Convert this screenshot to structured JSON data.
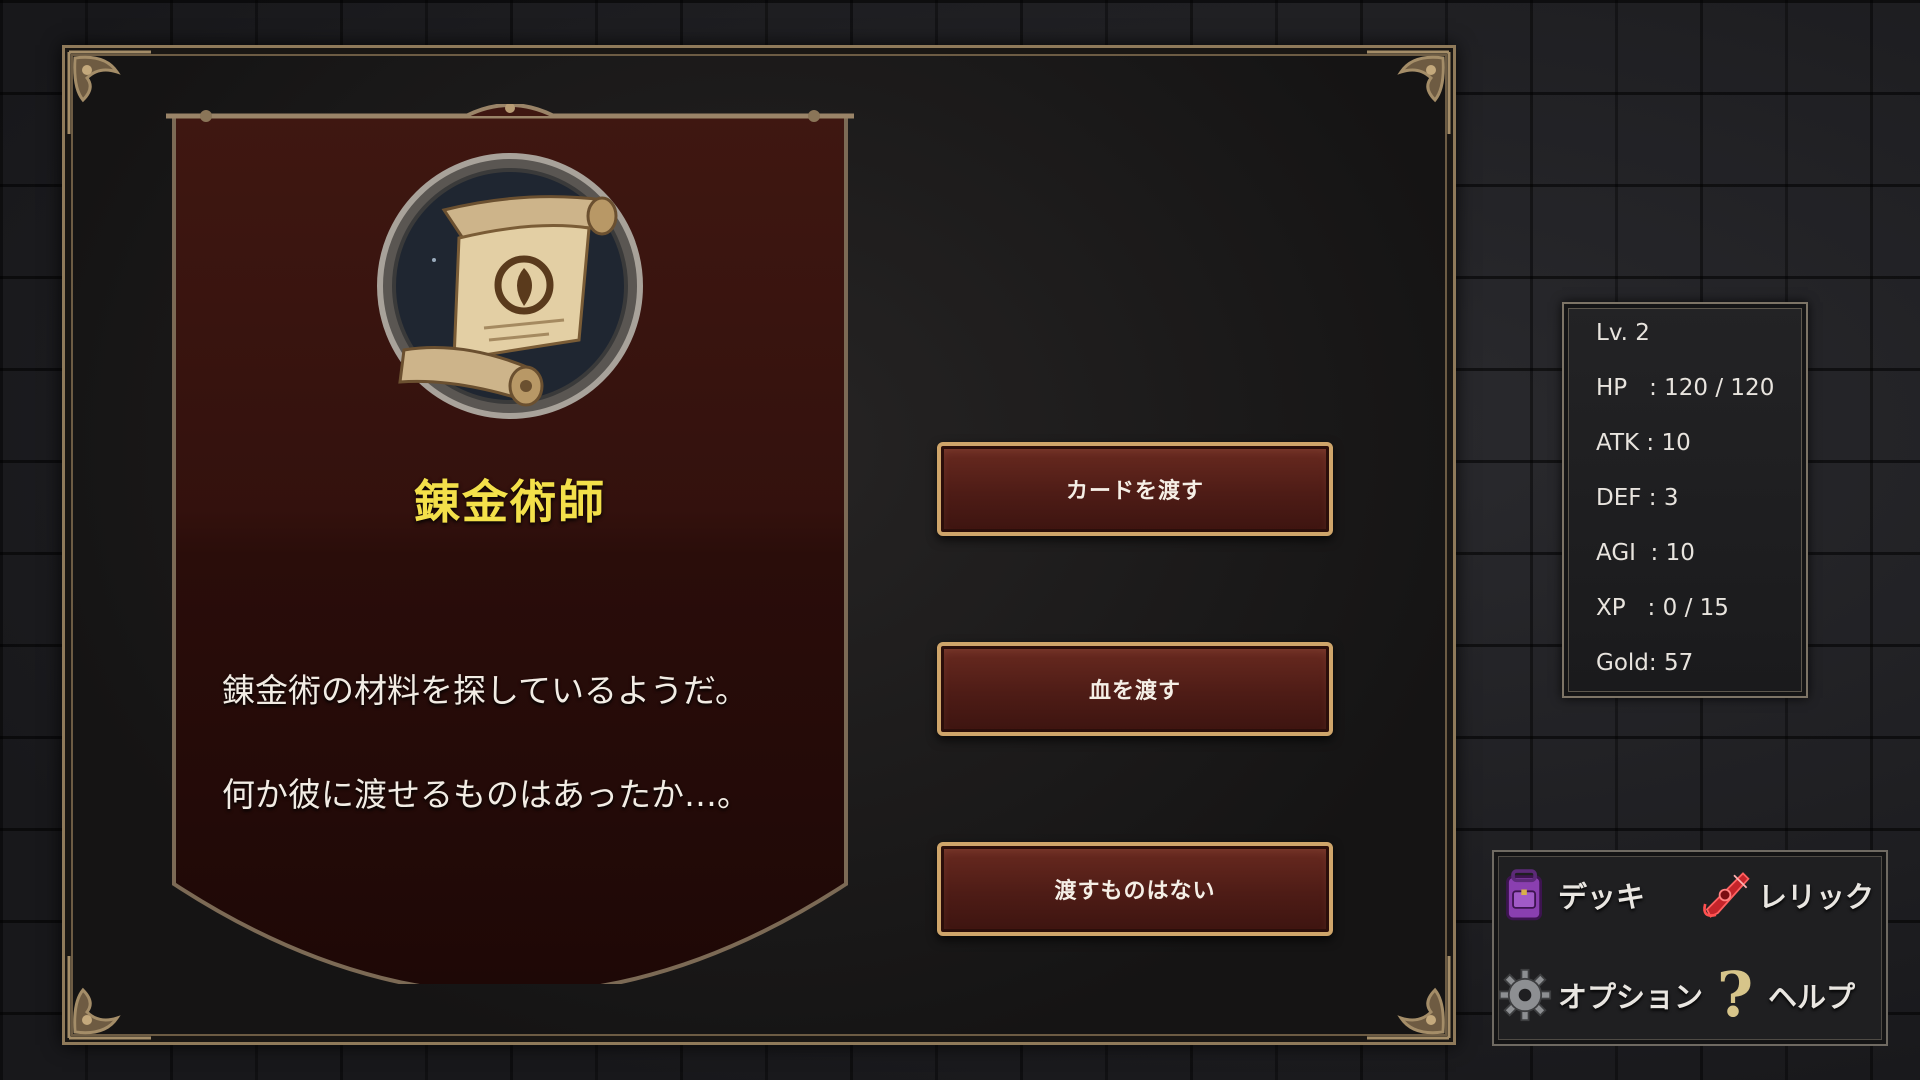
{
  "event": {
    "npc_name": "錬金術師",
    "portrait_icon": "scroll-emblem-icon",
    "description": [
      "錬金術の材料を探しているようだ。",
      "何か彼に渡せるものはあったか…。"
    ]
  },
  "choices": [
    {
      "label": "カードを渡す"
    },
    {
      "label": "血を渡す"
    },
    {
      "label": "渡すものはない"
    }
  ],
  "stats": {
    "level": "Lv. 2",
    "hp": "HP   : 120 / 120",
    "atk": "ATK : 10",
    "def": "DEF : 3",
    "agi": "AGI  : 10",
    "xp": "XP   : 0 / 15",
    "gold": "Gold: 57"
  },
  "menu": {
    "deck": {
      "label": "デッキ",
      "icon": "backpack-icon"
    },
    "relic": {
      "label": "レリック",
      "icon": "relic-icon"
    },
    "option": {
      "label": "オプション",
      "icon": "gear-icon"
    },
    "help": {
      "label": "ヘルプ",
      "icon": "question-icon"
    }
  },
  "colors": {
    "npc_name": "#f3e04a",
    "button_border": "#cfa56a",
    "button_fill": "#4e1c16",
    "banner_fill": "#3a1410"
  }
}
